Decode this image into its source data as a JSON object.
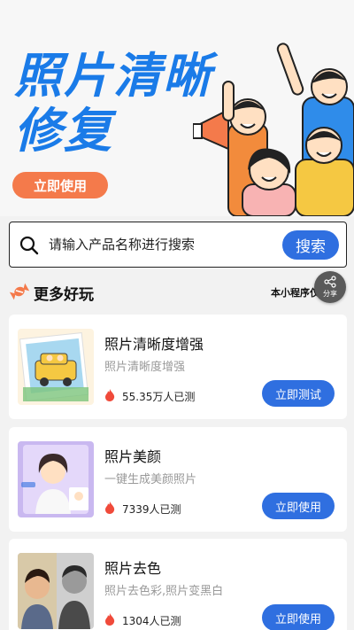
{
  "banner": {
    "title_line1": "照片清晰",
    "title_line2": "修复",
    "button_label": "立即使用"
  },
  "search": {
    "placeholder": "请输入产品名称进行搜索",
    "button_label": "搜索"
  },
  "section": {
    "title": "更多好玩",
    "note": "本小程序仅"
  },
  "share": {
    "label": "分享"
  },
  "cards": [
    {
      "title": "照片清晰度增强",
      "subtitle": "照片清晰度增强",
      "count": "55.35万人已测",
      "button": "立即测试"
    },
    {
      "title": "照片美颜",
      "subtitle": "一键生成美颜照片",
      "count": "7339人已测",
      "button": "立即使用"
    },
    {
      "title": "照片去色",
      "subtitle": "照片去色彩,照片变黑白",
      "count": "1304人已测",
      "button": "立即使用"
    }
  ],
  "colors": {
    "accent": "#2f6fe0",
    "banner_title": "#1a7be8",
    "banner_button": "#f47a4b",
    "fire": "#f04a3a"
  }
}
